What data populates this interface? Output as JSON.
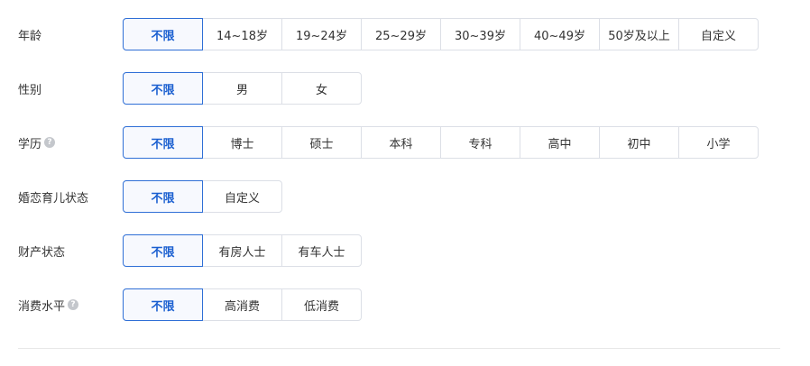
{
  "rows": [
    {
      "label": "年龄",
      "help": false,
      "options": [
        "不限",
        "14~18岁",
        "19~24岁",
        "25~29岁",
        "30~39岁",
        "40~49岁",
        "50岁及以上",
        "自定义"
      ],
      "selected": "不限"
    },
    {
      "label": "性别",
      "help": false,
      "options": [
        "不限",
        "男",
        "女"
      ],
      "selected": "不限"
    },
    {
      "label": "学历",
      "help": true,
      "options": [
        "不限",
        "博士",
        "硕士",
        "本科",
        "专科",
        "高中",
        "初中",
        "小学"
      ],
      "selected": "不限"
    },
    {
      "label": "婚恋育儿状态",
      "help": false,
      "options": [
        "不限",
        "自定义"
      ],
      "selected": "不限"
    },
    {
      "label": "财产状态",
      "help": false,
      "options": [
        "不限",
        "有房人士",
        "有车人士"
      ],
      "selected": "不限"
    },
    {
      "label": "消费水平",
      "help": true,
      "options": [
        "不限",
        "高消费",
        "低消费"
      ],
      "selected": "不限"
    }
  ],
  "help_icon": "question-circle-icon",
  "help_glyph": "?",
  "colors": {
    "accent": "#2f6fd6",
    "border": "#dcdfe6",
    "text": "#333333",
    "active_bg": "#f7f9fe"
  }
}
